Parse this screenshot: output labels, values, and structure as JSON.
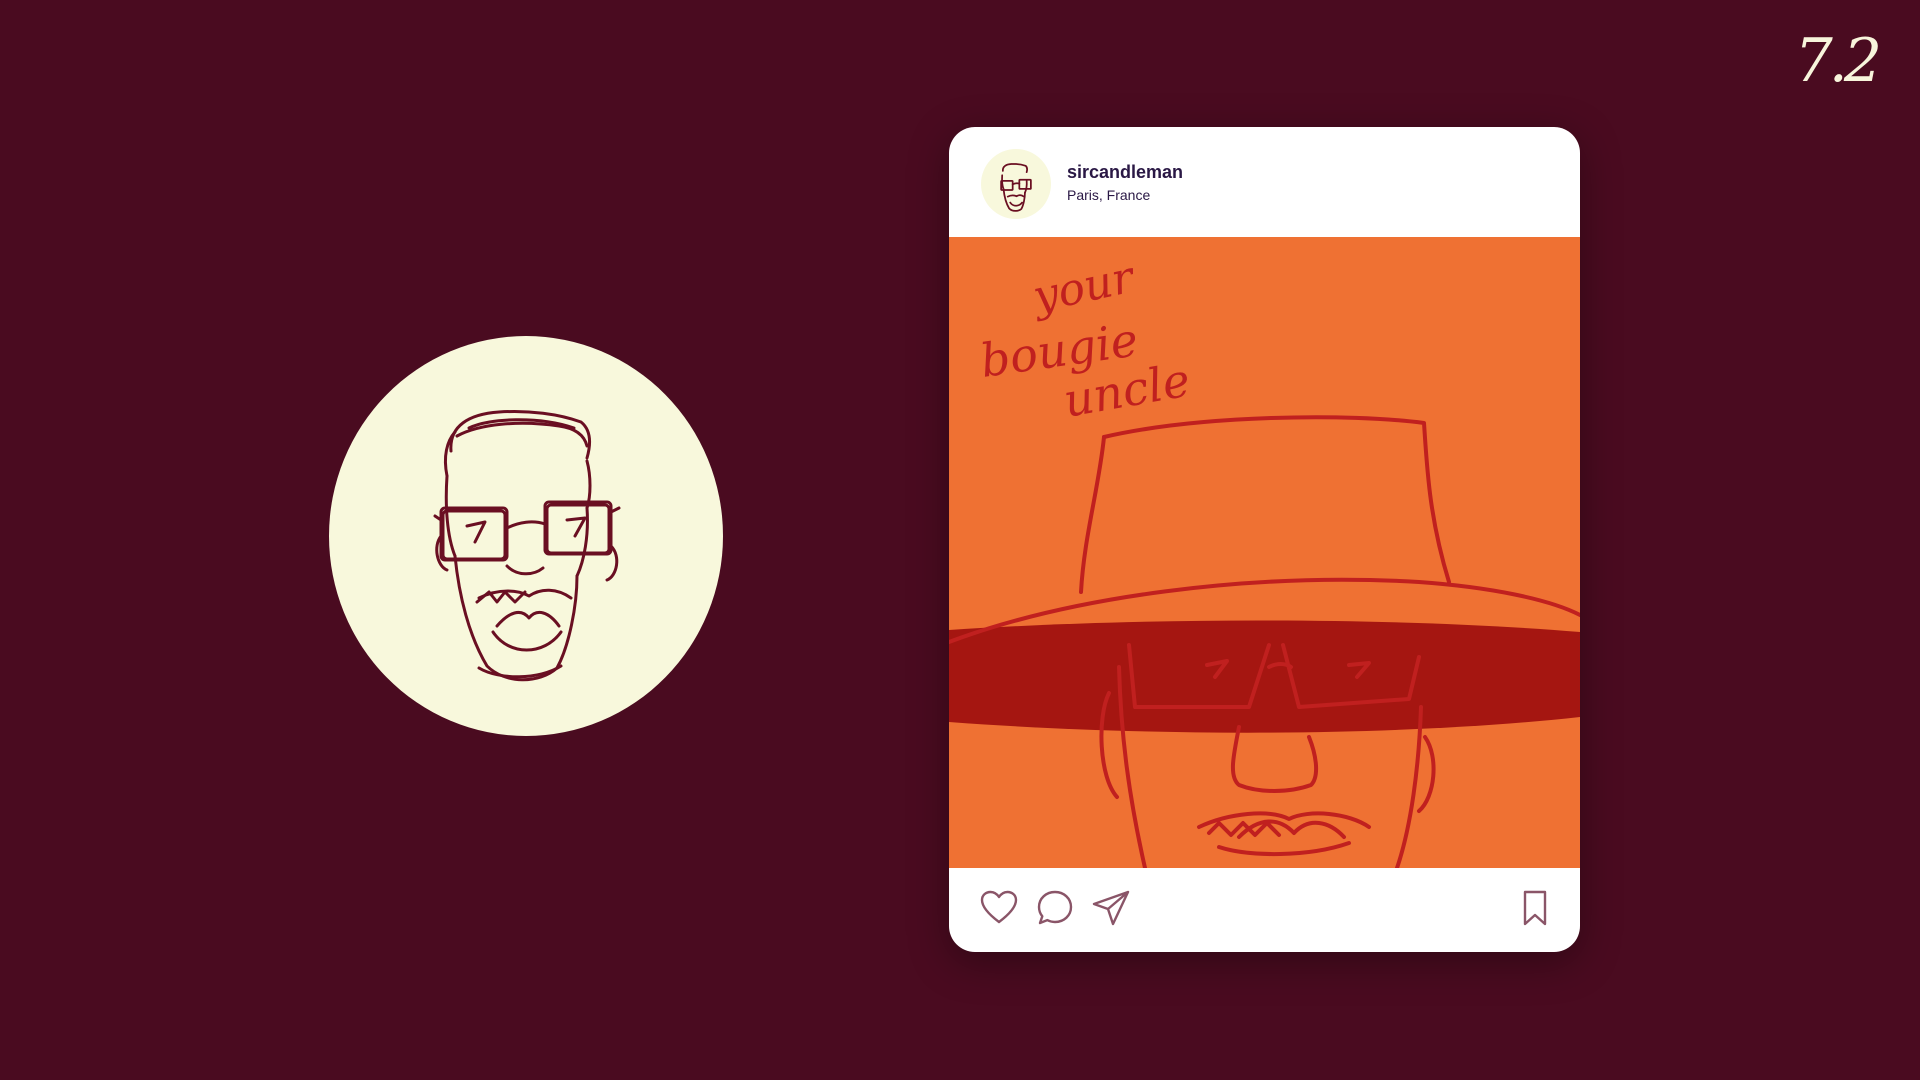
{
  "slide": {
    "number": "7.2"
  },
  "post": {
    "username": "sircandleman",
    "location": "Paris, France",
    "image_text": [
      "your",
      "bougie",
      "uncle"
    ]
  },
  "colors": {
    "background": "#4a0b20",
    "cream": "#f8f8dc",
    "orange": "#ef7133",
    "sketch_red": "#c0201f",
    "hat_band": "#a51611",
    "text_dark": "#2a1845",
    "icon_outline": "#8a5568"
  },
  "icons": {
    "like": "heart-icon",
    "comment": "comment-bubble-icon",
    "share": "paper-plane-icon",
    "save": "bookmark-icon"
  }
}
